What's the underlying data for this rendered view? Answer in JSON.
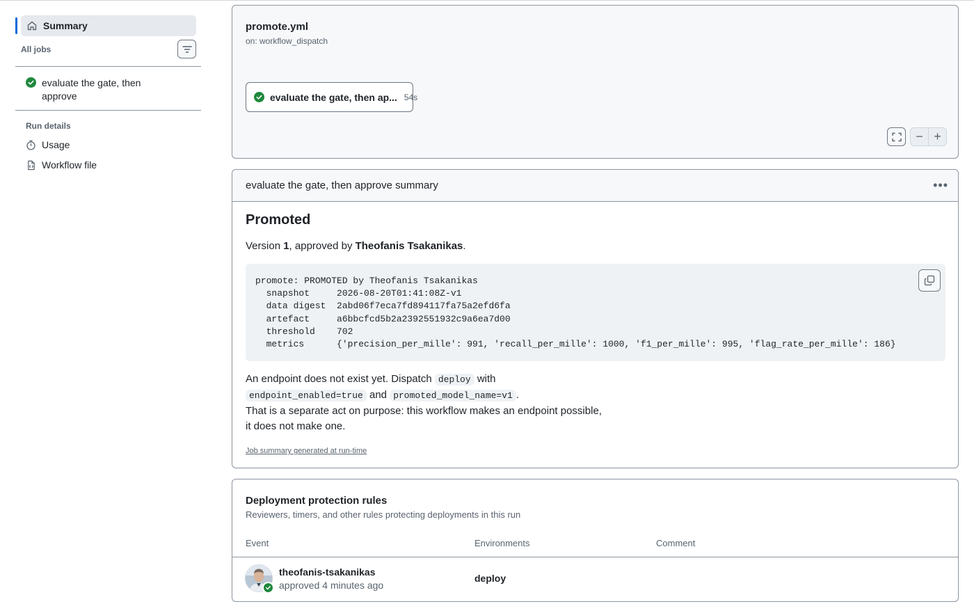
{
  "sidebar": {
    "summary_label": "Summary",
    "all_jobs_label": "All jobs",
    "jobs": [
      {
        "label": "evaluate the gate, then approve",
        "status": "success"
      }
    ],
    "run_details_label": "Run details",
    "usage_label": "Usage",
    "workflow_file_label": "Workflow file"
  },
  "workflow": {
    "file_name": "promote.yml",
    "trigger": "on: workflow_dispatch",
    "job_chip": {
      "name": "evaluate the gate, then ap...",
      "duration": "54s",
      "status": "success"
    }
  },
  "summary": {
    "header": "evaluate the gate, then approve summary",
    "heading": "Promoted",
    "version_prefix": "Version ",
    "version": "1",
    "approved_by_text": ", approved by ",
    "approver": "Theofanis Tsakanikas",
    "period": ".",
    "code": "promote: PROMOTED by Theofanis Tsakanikas\n  snapshot     2026-08-20T01:41:08Z-v1\n  data digest  2abd06f7eca7fd894117fa75a2efd6fa\n  artefact     a6bbcfcd5b2a2392551932c9a6ea7d00\n  threshold    702\n  metrics      {'precision_per_mille': 991, 'recall_per_mille': 1000, 'f1_per_mille': 995, 'flag_rate_per_mille': 186}",
    "para_1": "An endpoint does not exist yet. Dispatch ",
    "code_deploy": "deploy",
    "para_2": " with",
    "code_enabled": "endpoint_enabled=true",
    "para_and": " and ",
    "code_model": "promoted_model_name=v1",
    "para_3": ".",
    "para_4": "That is a separate act on purpose: this workflow makes an endpoint possible,",
    "para_5": "it does not make one.",
    "generated_note": "Job summary generated at run-time"
  },
  "deployment": {
    "title": "Deployment protection rules",
    "subtitle": "Reviewers, timers, and other rules protecting deployments in this run",
    "columns": {
      "event": "Event",
      "environments": "Environments",
      "comment": "Comment"
    },
    "rows": [
      {
        "user": "theofanis-tsakanikas",
        "action": "approved 4 minutes ago",
        "environment": "deploy",
        "comment": ""
      }
    ]
  },
  "colors": {
    "accent": "#0969da",
    "success": "#1f883d",
    "muted": "#59636e",
    "border": "#8c959f"
  },
  "icons": [
    "home-icon",
    "filter-icon",
    "check-circle-icon",
    "stopwatch-icon",
    "file-code-icon",
    "fullscreen-icon",
    "zoom-out-icon",
    "zoom-in-icon",
    "kebab-icon",
    "copy-icon"
  ]
}
